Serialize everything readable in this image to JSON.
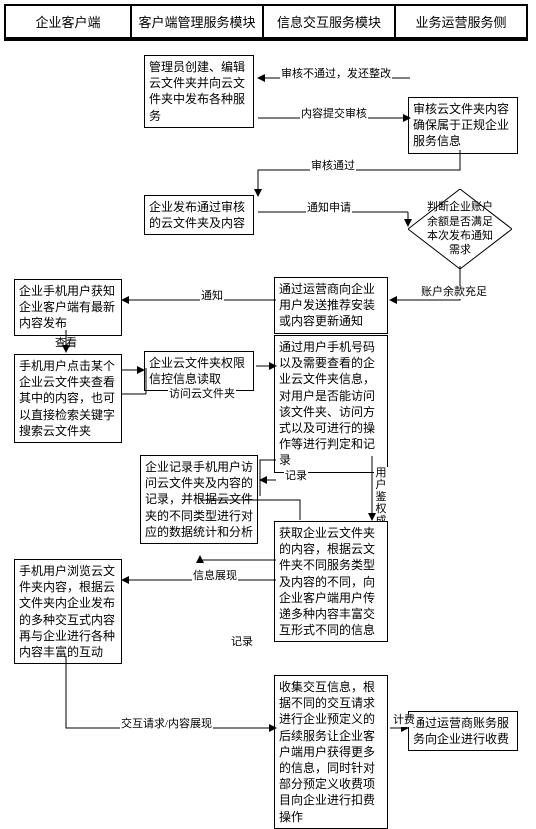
{
  "lanes": {
    "l1": {
      "title": "企业客户端"
    },
    "l2": {
      "title": "客户端管理服务模块"
    },
    "l3": {
      "title": "信息交互服务模块"
    },
    "l4": {
      "title": "业务运营服务侧"
    }
  },
  "boxes": {
    "b1": "管理员创建、编辑云文件夹并向云文件夹中发布各种服务",
    "b2": "审核云文件夹内容确保属于正规企业服务信息",
    "b3": "企业发布通过审核的云文件夹及内容",
    "b4": "判断企业账户余额是否满足本次发布通知需求",
    "b5": "通过运营商向企业用户发送推荐安装或内容更新通知",
    "b6": "企业手机用户获知企业客户端有最新内容发布",
    "b7": "手机用户点击某个企业云文件夹查看其中的内容，也可以直接检索关键字搜索云文件夹",
    "b8": "企业云文件夹权限信控信息读取",
    "b9": "通过用户手机号码以及需要查看的企业云文件夹信息，对用户是否能访问该文件夹、访问方式以及可进行的操作等进行判定和记录",
    "b10": "企业记录手机用户访问云文件夹及内容的记录，并根据云文件夹的不同类型进行对应的数据统计和分析",
    "b11": "获取企业云文件夹的内容，根据云文件夹不同服务类型及内容的不同，向企业客户端用户传递多种内容丰富交互形式不同的信息",
    "b12": "手机用户浏览云文件夹内容，根据云文件夹内企业发布的多种交互式内容再与企业进行各种内容丰富的互动",
    "b13": "收集交互信息，根据不同的交互请求进行企业预定义的后续服务让企业客户端用户获得更多的信息，同时针对部分预定义收费项目向企业进行扣费操作",
    "b14": "通过运营商账务服务向企业进行收费"
  },
  "edges": {
    "e1": "审核不通过，发还整改",
    "e2": "内容提交审核",
    "e3": "审核通过",
    "e4": "通知申请",
    "e5": "账户余款充足",
    "e6": "通知",
    "e7": "查看",
    "e8": "访问云文件夹",
    "e9": "记录",
    "e10": "用户鉴权成功",
    "e11": "信息展现",
    "e12": "记录",
    "e13": "交互请求/内容展现",
    "e14": "计费"
  },
  "chart_data": {
    "type": "swimlane-flow",
    "lanes": [
      "企业客户端",
      "客户端管理服务模块",
      "信息交互服务模块",
      "业务运营服务侧"
    ],
    "nodes": [
      {
        "id": "b1",
        "lane": 1,
        "text": "管理员创建、编辑云文件夹并向云文件夹中发布各种服务"
      },
      {
        "id": "b2",
        "lane": 3,
        "text": "审核云文件夹内容确保属于正规企业服务信息"
      },
      {
        "id": "b3",
        "lane": 1,
        "text": "企业发布通过审核的云文件夹及内容"
      },
      {
        "id": "b4",
        "lane": 3,
        "shape": "decision",
        "text": "判断企业账户余额是否满足本次发布通知需求"
      },
      {
        "id": "b5",
        "lane": 2,
        "text": "通过运营商向企业用户发送推荐安装或内容更新通知"
      },
      {
        "id": "b6",
        "lane": 0,
        "text": "企业手机用户获知企业客户端有最新内容发布"
      },
      {
        "id": "b7",
        "lane": 0,
        "text": "手机用户点击某个企业云文件夹查看其中的内容，也可以直接检索关键字搜索云文件夹"
      },
      {
        "id": "b8",
        "lane": 1,
        "text": "企业云文件夹权限信控信息读取"
      },
      {
        "id": "b9",
        "lane": 2,
        "text": "通过用户手机号码以及需要查看的企业云文件夹信息，对用户是否能访问该文件夹、访问方式以及可进行的操作等进行判定和记录"
      },
      {
        "id": "b10",
        "lane": 1,
        "text": "企业记录手机用户访问云文件夹及内容的记录，并根据云文件夹的不同类型进行对应的数据统计和分析"
      },
      {
        "id": "b11",
        "lane": 2,
        "text": "获取企业云文件夹的内容，根据云文件夹不同服务类型及内容的不同，向企业客户端用户传递多种内容丰富交互形式不同的信息"
      },
      {
        "id": "b12",
        "lane": 0,
        "text": "手机用户浏览云文件夹内容，根据云文件夹内企业发布的多种交互式内容再与企业进行各种内容丰富的互动"
      },
      {
        "id": "b13",
        "lane": 2,
        "text": "收集交互信息，根据不同的交互请求进行企业预定义的后续服务让企业客户端用户获得更多的信息，同时针对部分预定义收费项目向企业进行扣费操作"
      },
      {
        "id": "b14",
        "lane": 3,
        "text": "通过运营商账务服务向企业进行收费"
      }
    ],
    "edges": [
      {
        "from": "b2",
        "to": "b1",
        "label": "审核不通过，发还整改"
      },
      {
        "from": "b1",
        "to": "b2",
        "label": "内容提交审核"
      },
      {
        "from": "b2",
        "to": "b3",
        "label": "审核通过"
      },
      {
        "from": "b3",
        "to": "b4",
        "label": "通知申请"
      },
      {
        "from": "b4",
        "to": "b5",
        "label": "账户余款充足"
      },
      {
        "from": "b5",
        "to": "b6",
        "label": "通知"
      },
      {
        "from": "b6",
        "to": "b7",
        "label": "查看"
      },
      {
        "from": "b7",
        "to": "b8",
        "label": "访问云文件夹"
      },
      {
        "from": "b8",
        "to": "b9",
        "label": "访问云文件夹"
      },
      {
        "from": "b9",
        "to": "b10",
        "label": "记录"
      },
      {
        "from": "b9",
        "to": "b11",
        "label": "用户鉴权成功"
      },
      {
        "from": "b11",
        "to": "b12",
        "label": "信息展现"
      },
      {
        "from": "b11",
        "to": "b10",
        "label": "记录"
      },
      {
        "from": "b12",
        "to": "b13",
        "label": "交互请求/内容展现"
      },
      {
        "from": "b13",
        "to": "b14",
        "label": "计费"
      }
    ]
  }
}
